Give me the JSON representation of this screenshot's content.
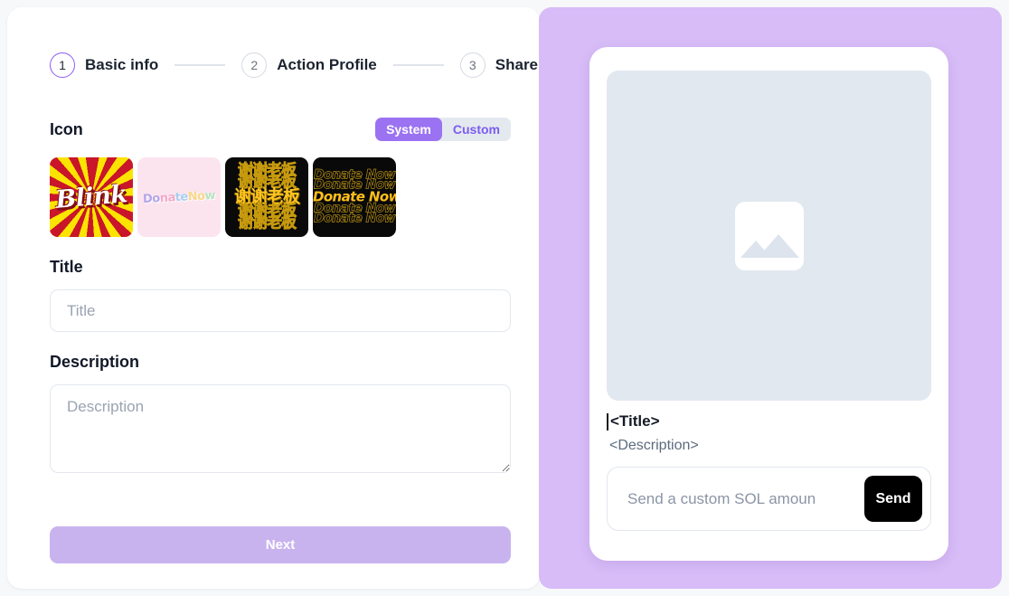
{
  "stepper": {
    "steps": [
      {
        "number": "1",
        "label": "Basic info",
        "active": true
      },
      {
        "number": "2",
        "label": "Action Profile",
        "active": false
      },
      {
        "number": "3",
        "label": "Share",
        "active": false
      }
    ]
  },
  "icon_section": {
    "label": "Icon",
    "toggle": {
      "system_label": "System",
      "custom_label": "Custom",
      "selected": "System"
    },
    "thumbnails": [
      {
        "name": "blink-sunburst",
        "text": "Blink"
      },
      {
        "name": "donate-now-pastel",
        "text": "Donate Now"
      },
      {
        "name": "xiexie-laoban-gold",
        "text": "谢谢老板"
      },
      {
        "name": "donate-now-gold",
        "text": "Donate Now"
      }
    ]
  },
  "title_field": {
    "label": "Title",
    "placeholder": "Title",
    "value": ""
  },
  "description_field": {
    "label": "Description",
    "placeholder": "Description",
    "value": ""
  },
  "next_button": {
    "label": "Next"
  },
  "preview": {
    "image_placeholder_icon": "image-placeholder-icon",
    "title": "<Title>",
    "description": "<Description>",
    "amount_input": {
      "placeholder": "Send a custom SOL amoun",
      "value": ""
    },
    "send_button_label": "Send"
  },
  "colors": {
    "accent_purple": "#9b72f2",
    "panel_purple": "#d7bcf7",
    "next_disabled": "#c9b3ef",
    "image_box": "#e2e8f0",
    "send_button": "#000000"
  }
}
